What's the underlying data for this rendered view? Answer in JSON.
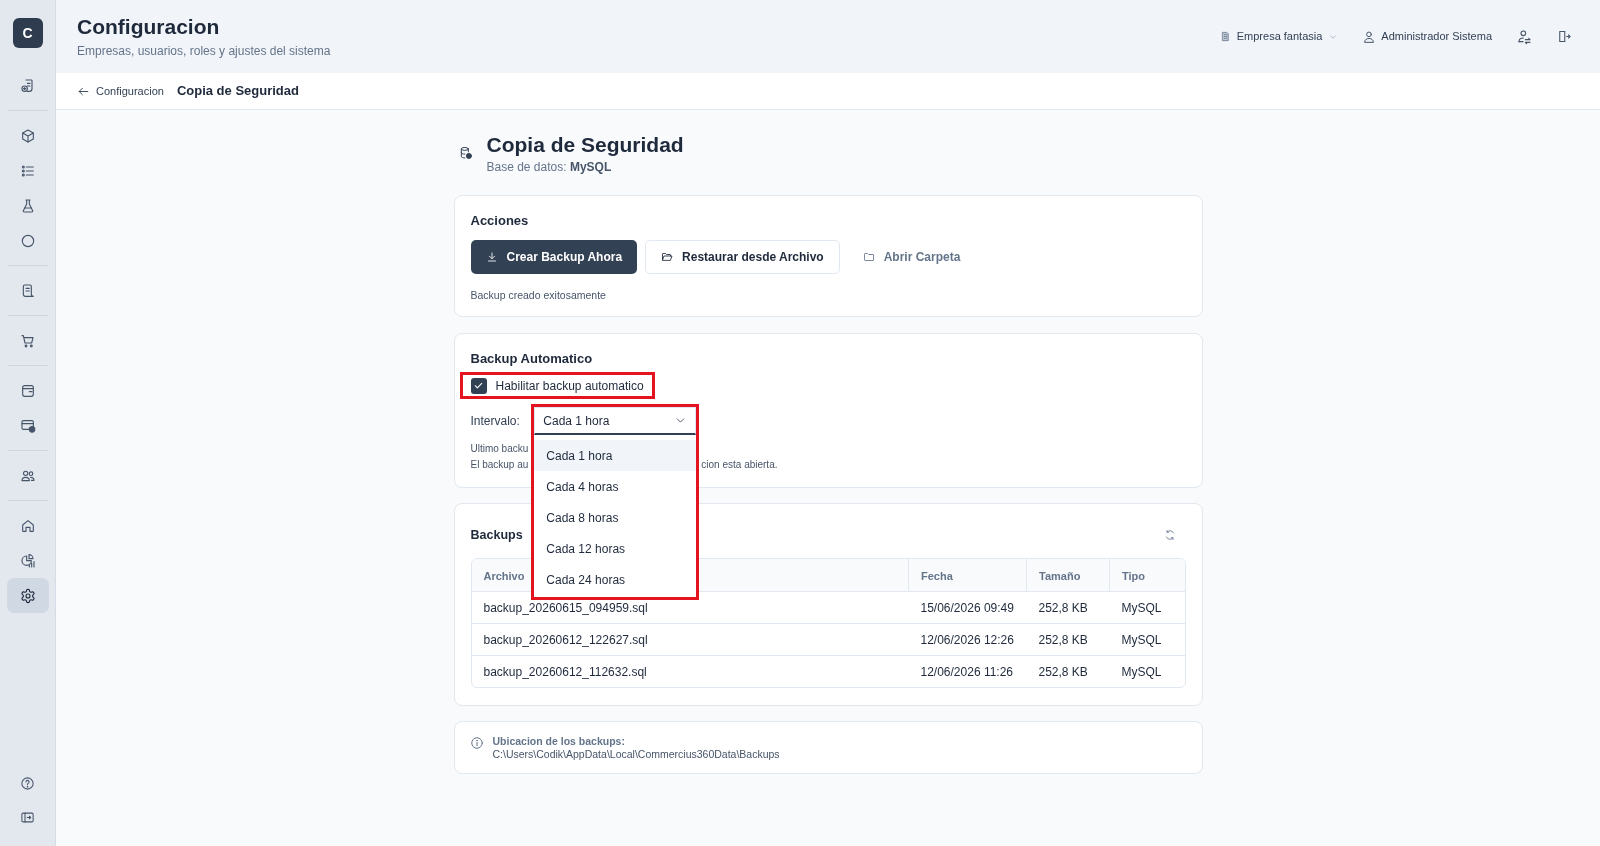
{
  "sidebar": {
    "logo": "C",
    "groups": [
      {
        "items": [
          {
            "selected": false
          }
        ]
      },
      {
        "items": [
          {
            "selected": false
          },
          {
            "selected": false
          },
          {
            "selected": false
          },
          {
            "selected": false
          }
        ]
      },
      {
        "items": [
          {
            "selected": false
          }
        ]
      },
      {
        "items": [
          {
            "selected": false
          }
        ]
      },
      {
        "items": [
          {
            "selected": false
          },
          {
            "selected": false
          }
        ]
      },
      {
        "items": [
          {
            "selected": false
          }
        ]
      },
      {
        "items": [
          {
            "selected": false
          },
          {
            "selected": false
          },
          {
            "selected": true
          }
        ]
      }
    ]
  },
  "header": {
    "title": "Configuracion",
    "subtitle": "Empresas, usuarios, roles y ajustes del sistema",
    "company": "Empresa fantasia",
    "user": "Administrador Sistema"
  },
  "breadcrumb": {
    "back": "Configuracion",
    "current": "Copia de Seguridad"
  },
  "page": {
    "title": "Copia de Seguridad",
    "subtitle": "Base de datos: **MySQL**"
  },
  "actions": {
    "title": "Acciones",
    "buttons": [
      {
        "label": "Crear Backup Ahora",
        "kind": "primary"
      },
      {
        "label": "Restaurar desde Archivo",
        "kind": "outline"
      },
      {
        "label": "Abrir Carpeta",
        "kind": "ghost"
      }
    ],
    "status": "Backup creado exitosamente"
  },
  "auto_backup": {
    "title": "Backup Automatico",
    "enable": {
      "label": "Habilitar backup automatico",
      "checked": true,
      "highlighted": true
    },
    "interval": {
      "label": "Intervalo:",
      "value": "Cada 1 hora",
      "expanded": true,
      "highlighted": true,
      "options": [
        {
          "label": "Cada 1 hora",
          "selected": true
        },
        {
          "label": "Cada 4 horas",
          "selected": false
        },
        {
          "label": "Cada 8 horas",
          "selected": false
        },
        {
          "label": "Cada 12 horas",
          "selected": false
        },
        {
          "label": "Cada 24 horas",
          "selected": false
        }
      ]
    },
    "notes": [
      {
        "start": "Ultimo backu"
      },
      {
        "start": "El backup au",
        "end": "cion esta abierta."
      }
    ]
  },
  "backups": {
    "title": "Backups",
    "table": {
      "columns": [
        "Archivo",
        "Fecha",
        "Tamaño",
        "Tipo"
      ],
      "rows": [
        [
          "backup_20260615_094959.sql",
          "15/06/2026 09:49",
          "252,8 KB",
          "MySQL"
        ],
        [
          "backup_20260612_122627.sql",
          "12/06/2026 12:26",
          "252,8 KB",
          "MySQL"
        ],
        [
          "backup_20260612_112632.sql",
          "12/06/2026 11:26",
          "252,8 KB",
          "MySQL"
        ]
      ]
    }
  },
  "location": {
    "label": "Ubicacion de los backups:",
    "path": "C:\\Users\\Codik\\AppData\\Local\\Commercius360Data\\Backups"
  }
}
